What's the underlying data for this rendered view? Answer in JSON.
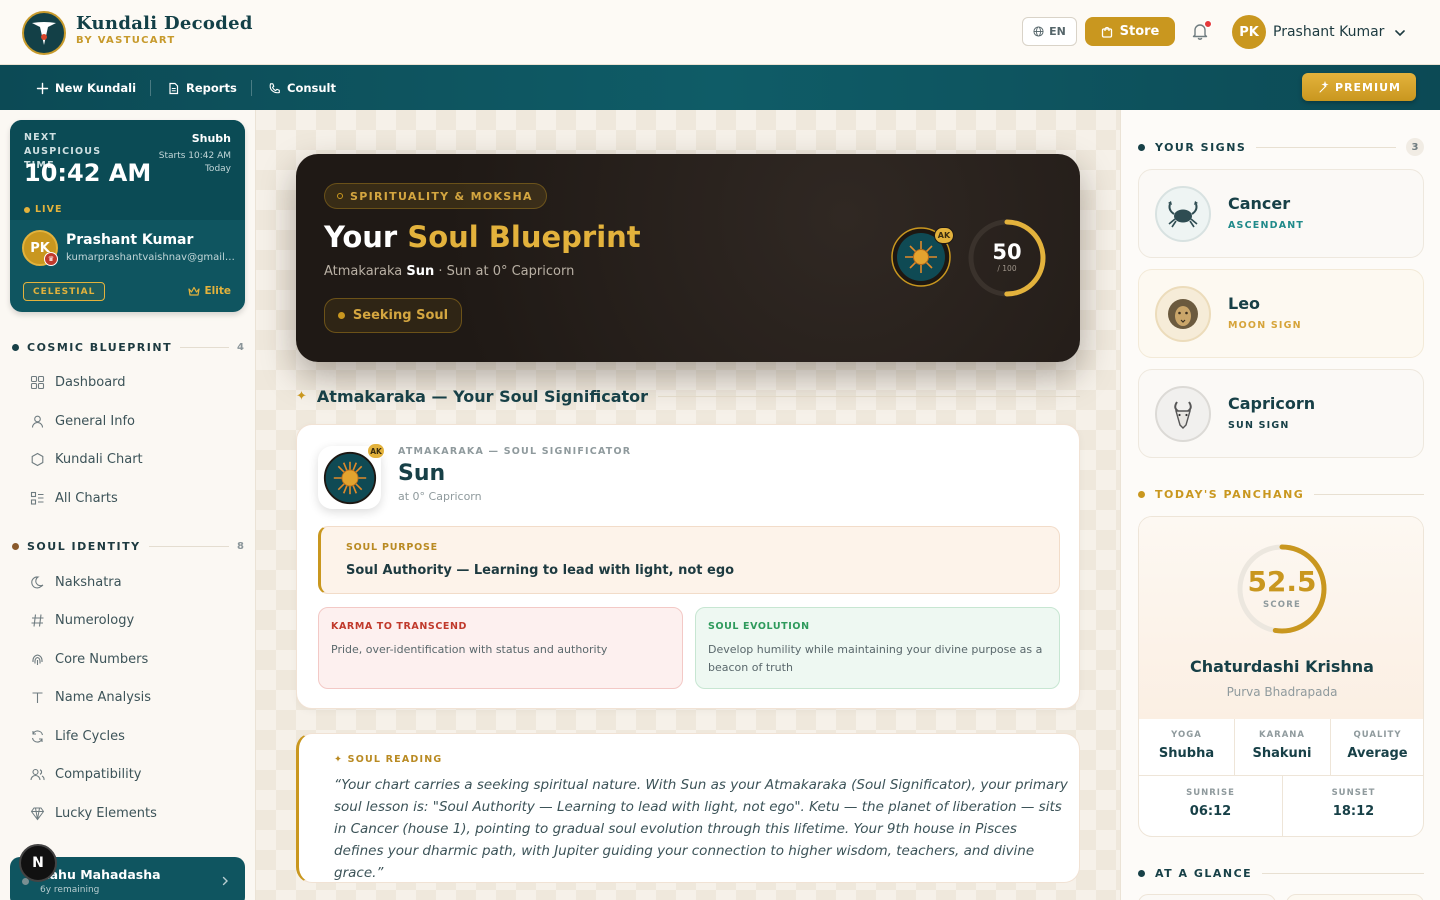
{
  "header": {
    "brand_name": "Kundali Decoded",
    "brand_sub": "BY VASTUCART",
    "lang": "EN",
    "store_label": "Store",
    "user_initials": "PK",
    "user_name": "Prashant Kumar"
  },
  "nav": {
    "items": [
      {
        "label": "New Kundali",
        "icon": "plus-icon"
      },
      {
        "label": "Reports",
        "icon": "document-icon"
      },
      {
        "label": "Consult",
        "icon": "phone-icon"
      }
    ],
    "premium_label": "PREMIUM"
  },
  "sidebar": {
    "profile": {
      "next_label": "NEXT AUSPICIOUS TIME",
      "shubh": "Shubh",
      "starts": "Starts 10:42 AM",
      "starts_day": "Today",
      "time": "10:42 AM",
      "live": "LIVE",
      "initials": "PK",
      "name": "Prashant Kumar",
      "email": "kumarprashantvaishnav@gmail.com",
      "tier": "CELESTIAL",
      "elite": "Elite"
    },
    "sections": [
      {
        "title": "COSMIC BLUEPRINT",
        "count": "4",
        "color": "#174047"
      },
      {
        "title": "SOUL IDENTITY",
        "count": "8",
        "color": "#8a5a2b"
      }
    ],
    "cosmic_items": [
      {
        "label": "Dashboard",
        "icon": "grid-icon"
      },
      {
        "label": "General Info",
        "icon": "user-icon"
      },
      {
        "label": "Kundali Chart",
        "icon": "hexagon-icon"
      },
      {
        "label": "All Charts",
        "icon": "list-icon"
      }
    ],
    "soul_items": [
      {
        "label": "Nakshatra",
        "icon": "moon-icon"
      },
      {
        "label": "Numerology",
        "icon": "hash-icon"
      },
      {
        "label": "Core Numbers",
        "icon": "fingerprint-icon"
      },
      {
        "label": "Name Analysis",
        "icon": "type-icon"
      },
      {
        "label": "Life Cycles",
        "icon": "refresh-icon"
      },
      {
        "label": "Compatibility",
        "icon": "users-icon"
      },
      {
        "label": "Lucky Elements",
        "icon": "gem-icon"
      }
    ],
    "dasha": {
      "title": "Rahu Mahadasha",
      "sub": "6y remaining"
    }
  },
  "hero": {
    "pill": "SPIRITUALITY & MOKSHA",
    "title_a": "Your ",
    "title_b": "Soul Blueprint",
    "sub_a": "Atmakaraka ",
    "sub_b": "Sun",
    "sub_c": " · Sun at 0° Capricorn",
    "seek": "Seeking Soul",
    "ak": "AK",
    "score": "50",
    "score_max": "/ 100",
    "score_value": 50
  },
  "atmakaraka": {
    "section_title": "Atmakaraka — Your Soul Significator",
    "eyebrow": "ATMAKARAKA — SOUL SIGNIFICATOR",
    "planet": "Sun",
    "position": "at 0° Capricorn",
    "ak": "AK",
    "purpose_label": "SOUL PURPOSE",
    "purpose_text": "Soul Authority — Learning to lead with light, not ego",
    "karma_label": "KARMA TO TRANSCEND",
    "karma_text": "Pride, over-identification with status and authority",
    "evo_label": "SOUL EVOLUTION",
    "evo_text": "Develop humility while maintaining your divine purpose as a beacon of truth"
  },
  "reading": {
    "label": "SOUL READING",
    "text": "“Your chart carries a seeking spiritual nature. With Sun as your Atmakaraka (Soul Significator), your primary soul lesson is: \"Soul Authority — Learning to lead with light, not ego\". Ketu — the planet of liberation — sits in Cancer (house 1), pointing to gradual soul evolution through this lifetime. Your 9th house in Pisces defines your dharmic path, with Jupiter guiding your connection to higher wisdom, teachers, and divine grace.”"
  },
  "right": {
    "signs_title": "YOUR SIGNS",
    "signs_count": "3",
    "signs": [
      {
        "name": "Cancer",
        "role": "ASCENDANT",
        "color": "#1f8a8a",
        "icon": "crab-icon"
      },
      {
        "name": "Leo",
        "role": "MOON SIGN",
        "color": "#d6a43a",
        "icon": "lion-icon"
      },
      {
        "name": "Capricorn",
        "role": "SUN SIGN",
        "color": "#174047",
        "icon": "goat-icon"
      }
    ],
    "panchang_title": "TODAY'S PANCHANG",
    "panchang": {
      "score": "52.5",
      "score_value": 52.5,
      "score_label": "SCORE",
      "tithi": "Chaturdashi Krishna",
      "nakshatra": "Purva Bhadrapada",
      "yoga_label": "YOGA",
      "yoga": "Shubha",
      "karana_label": "KARANA",
      "karana": "Shakuni",
      "quality_label": "QUALITY",
      "quality": "Average",
      "sunrise_label": "SUNRISE",
      "sunrise": "06:12",
      "sunset_label": "SUNSET",
      "sunset": "18:12"
    },
    "glance_title": "AT A GLANCE"
  }
}
